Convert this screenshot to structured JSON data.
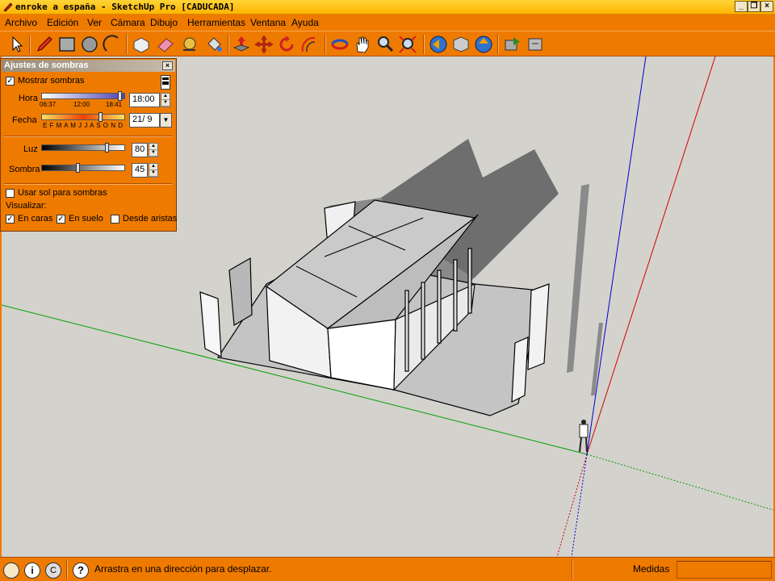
{
  "window": {
    "title": "enroke a españa - SketchUp Pro [CADUCADA]",
    "controls": [
      "minimize",
      "restore",
      "close"
    ]
  },
  "menu": [
    {
      "label": "Archivo"
    },
    {
      "label": "Edición"
    },
    {
      "label": "Ver"
    },
    {
      "label": "Cámara"
    },
    {
      "label": "Dibujo"
    },
    {
      "label": "Herramientas"
    },
    {
      "label": "Ventana"
    },
    {
      "label": "Ayuda"
    }
  ],
  "toolbar": {
    "tools": [
      "select-icon",
      "pencil-icon",
      "rectangle-icon",
      "circle-icon",
      "arc-icon",
      "make-component-icon",
      "eraser-icon",
      "tape-measure-icon",
      "paint-bucket-icon",
      "push-pull-icon",
      "move-icon",
      "rotate-icon",
      "offset-icon",
      "orbit-icon",
      "pan-icon",
      "zoom-icon",
      "zoom-extents-icon",
      "previous-view-icon",
      "next-view-icon",
      "get-models-icon",
      "share-model-icon",
      "share-component-icon",
      "components-icon"
    ]
  },
  "shadow_panel": {
    "title": "Ajustes de sombras",
    "show_shadows_label": "Mostrar sombras",
    "show_shadows_checked": true,
    "time_label": "Hora",
    "time_ticks": [
      "06:37",
      "12:00",
      "18:41"
    ],
    "time_value": "18:00",
    "date_label": "Fecha",
    "date_ticks": "E F M A M J J A S O N D",
    "date_value": "21/ 9",
    "light_label": "Luz",
    "light_value": "80",
    "shade_label": "Sombra",
    "shade_value": "45",
    "use_sun_label": "Usar sol para sombras",
    "use_sun_checked": false,
    "display_label": "Visualizar:",
    "on_faces_label": "En caras",
    "on_faces_checked": true,
    "on_ground_label": "En suelo",
    "on_ground_checked": true,
    "from_edges_label": "Desde aristas",
    "from_edges_checked": false
  },
  "status": {
    "message": "Arrastra en una dirección para desplazar.",
    "measure_label": "Medidas",
    "measure_value": ""
  },
  "colors": {
    "chrome": "#ef7a00",
    "viewport": "#d4d2cd",
    "axis_red": "#d40000",
    "axis_green": "#00a000",
    "axis_blue": "#0000d0"
  }
}
